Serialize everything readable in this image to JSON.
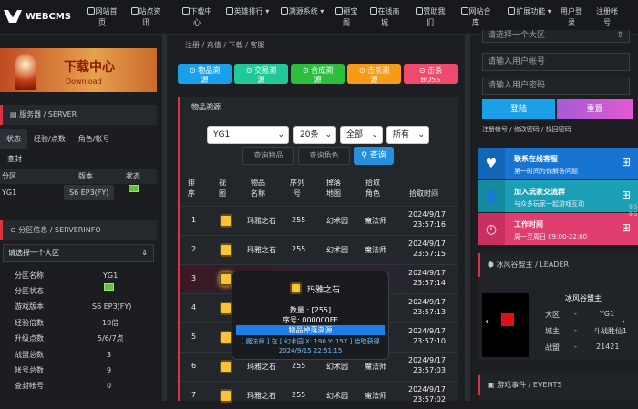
{
  "nav": {
    "logo": "WEBCMS",
    "items": [
      {
        "icon": "home-icon",
        "l1": "网站首",
        "l2": "页"
      },
      {
        "icon": "news-icon",
        "l1": "站点资",
        "l2": "讯"
      },
      {
        "icon": "download-icon",
        "l1": "下载中",
        "l2": "心"
      },
      {
        "icon": "rank-icon",
        "l1": "英雄排行",
        "l2": "▾"
      },
      {
        "icon": "server-icon",
        "l1": "溯源系统",
        "l2": "▾"
      },
      {
        "icon": "lottery-icon",
        "l1": "砸宝",
        "l2": "阁"
      },
      {
        "icon": "shop-icon",
        "l1": "在线商",
        "l2": "城"
      },
      {
        "icon": "donate-icon",
        "l1": "赞助我",
        "l2": "们"
      },
      {
        "icon": "library-icon",
        "l1": "网站合",
        "l2": "库"
      },
      {
        "icon": "expand-icon",
        "l1": "扩展功能",
        "l2": "▾"
      },
      {
        "icon": "",
        "l1": "用户登",
        "l2": "录"
      },
      {
        "icon": "",
        "l1": "注册帐",
        "l2": "号"
      }
    ]
  },
  "banner": {
    "title": "下载中心",
    "sub": "Download"
  },
  "server": {
    "header": "服务器 / SERVER",
    "tabs": [
      "状态",
      "经验/点数",
      "角色/帐号"
    ],
    "query": "查封",
    "cols": [
      "分区",
      "版本",
      "状态"
    ],
    "row": {
      "zone": "YG1",
      "version": "S6 EP3(FY)"
    }
  },
  "zone": {
    "header": "分区信息 / SERVERINFO",
    "select": "请选择一个大区",
    "rows": [
      {
        "k": "分区名称",
        "v": "YG1"
      },
      {
        "k": "分区状态",
        "v": ""
      },
      {
        "k": "游戏版本",
        "v": "S6 EP3(FY)"
      },
      {
        "k": "经验倍数",
        "v": "10倍"
      },
      {
        "k": "升级点数",
        "v": "5/6/7点"
      },
      {
        "k": "战盟总数",
        "v": "3"
      },
      {
        "k": "帐号总数",
        "v": "9"
      },
      {
        "k": "查封帐号",
        "v": "0"
      }
    ]
  },
  "breadcrumb": "注册 / 充值 / 下载 / 客服",
  "buttons": [
    {
      "icon": "⊙",
      "l1": "物品溯",
      "l2": "源",
      "color": "#1aa0e8"
    },
    {
      "icon": "⊙",
      "l1": "交易溯",
      "l2": "源",
      "color": "#20c997"
    },
    {
      "icon": "⊙",
      "l1": "合成溯",
      "l2": "源",
      "color": "#2cbf3e"
    },
    {
      "icon": "⊙",
      "l1": "击杀溯",
      "l2": "源",
      "color": "#f59b18"
    },
    {
      "icon": "⊙",
      "l1": "击杀",
      "l2": "BOSS",
      "color": "#ef4a6e"
    }
  ],
  "section": {
    "title": "物品溯源"
  },
  "filters": {
    "zone": "YG1",
    "count": "20条",
    "type": "全部",
    "time": "所有",
    "item_ph": "查询物品",
    "role_ph": "查询角色",
    "query": "查询"
  },
  "table": {
    "cols": [
      "排\n序",
      "视\n图",
      "物品\n名称",
      "序列\n号",
      "掉落\n地图",
      "拾取\n角色",
      "拾取时间"
    ],
    "rows": [
      {
        "n": "1",
        "name": "玛雅之石",
        "sn": "255",
        "map": "幻术园",
        "role": "魔法师",
        "d": "2024/9/17",
        "t": "23:57:16"
      },
      {
        "n": "2",
        "name": "玛雅之石",
        "sn": "255",
        "map": "幻术园",
        "role": "魔法师",
        "d": "2024/9/17",
        "t": "23:57:15"
      },
      {
        "n": "3",
        "name": "",
        "sn": "",
        "map": "",
        "role": "",
        "d": "2024/9/17",
        "t": "23:57:14"
      },
      {
        "n": "4",
        "name": "",
        "sn": "",
        "map": "",
        "role": "",
        "d": "2024/9/17",
        "t": "23:57:13"
      },
      {
        "n": "5",
        "name": "",
        "sn": "",
        "map": "",
        "role": "",
        "d": "2024/9/17",
        "t": "23:57:10"
      },
      {
        "n": "6",
        "name": "玛雅之石",
        "sn": "255",
        "map": "幻术园",
        "role": "魔法师",
        "d": "2024/9/17",
        "t": "23:57:03"
      },
      {
        "n": "7",
        "name": "玛雅之石",
        "sn": "255",
        "map": "幻术园",
        "role": "魔法师",
        "d": "2024/9/17",
        "t": "23:57:02"
      }
    ]
  },
  "tooltip": {
    "name": "玛雅之石",
    "qty": "数量 : [255]",
    "serial": "序号: 000000FF",
    "tag": "物品掉落溯源",
    "info": "[ 魔法师 ] 在 [ 幻术园 X: 190 Y: 157 ] 拾取获得",
    "time": "2024/9/15 22:51:15"
  },
  "login": {
    "select": "请选择一个大区",
    "user_ph": "请输入用户帐号",
    "pass_ph": "请输入用户密码",
    "login": "登陆",
    "reset": "重置",
    "links": "注册帐号 / 修改密码 / 找回密码"
  },
  "contact": [
    {
      "icon": "heart-icon",
      "title": "联系在线客服",
      "sub": "第一时间为你解答问题",
      "color": "#1775d1",
      "iconbg": "#1266b8"
    },
    {
      "icon": "group-icon",
      "title": "加入玩家交流群",
      "sub": "与众多玩家一起游戏互动",
      "color": "#1a9fb5",
      "iconbg": "#148aa0"
    },
    {
      "icon": "clock-icon",
      "title": "工作时间",
      "sub": "周一至周日 09:00-22:00",
      "color": "#df3e6f",
      "iconbg": "#c73060"
    }
  ],
  "leader": {
    "header": "冰风谷盟主 / LEADER",
    "name": "冰风谷盟主",
    "rows": [
      {
        "k": "大区",
        "v": "YG1"
      },
      {
        "k": "城主",
        "v": "斗战胜仙1"
      },
      {
        "k": "战盟",
        "v": "21421"
      }
    ]
  },
  "events": {
    "header": "游戏事件 / EVENTS"
  },
  "side_badges": [
    "9.5",
    "9.5"
  ]
}
